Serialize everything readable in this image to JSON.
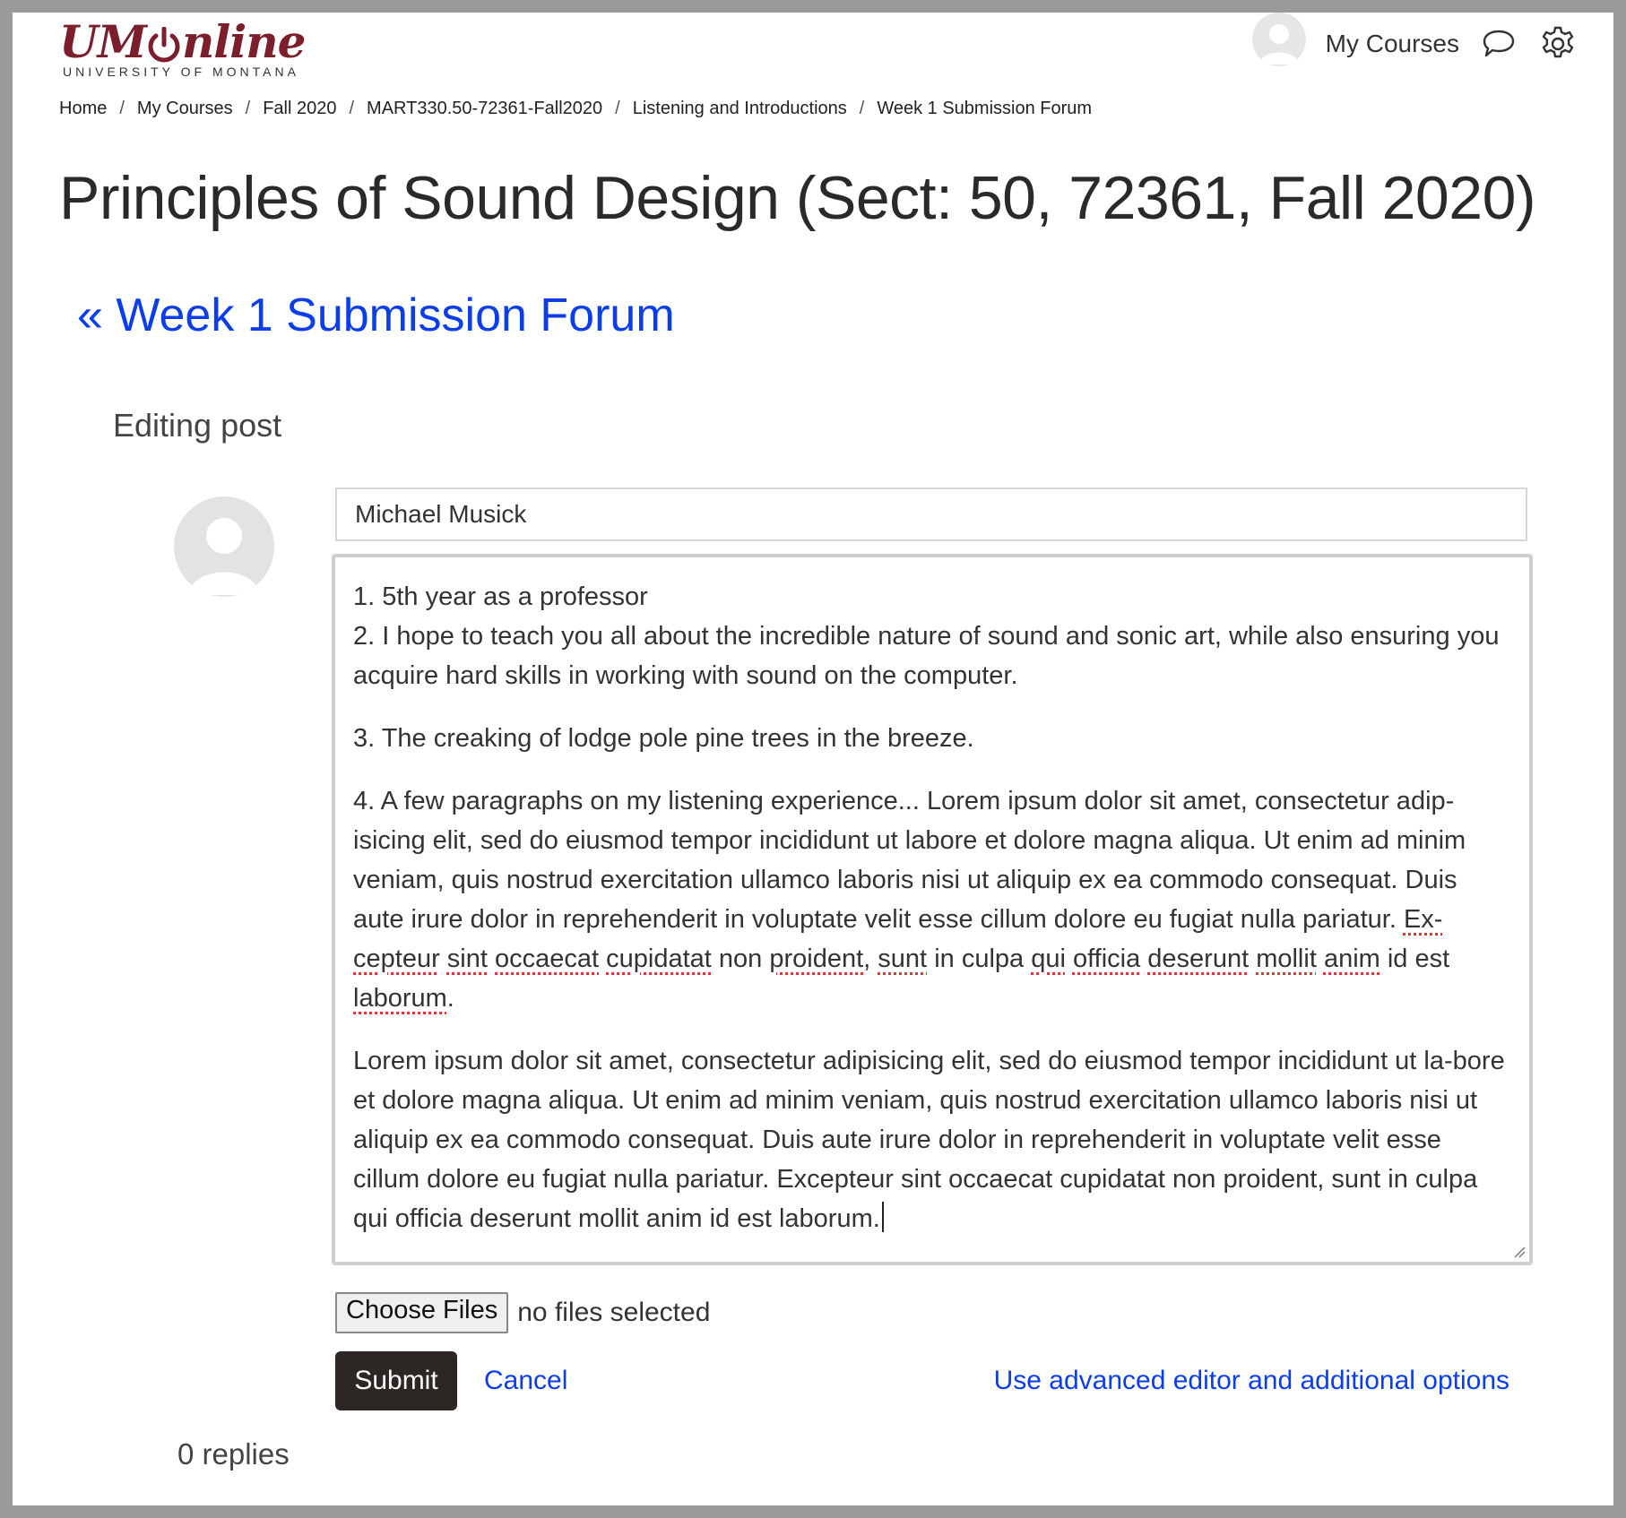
{
  "header": {
    "logo_main": "UM",
    "logo_main_rest": "nline",
    "logo_sub": "UNIVERSITY OF MONTANA",
    "my_courses": "My Courses",
    "brand_color": "#7a1f2b"
  },
  "breadcrumb": [
    {
      "label": "Home"
    },
    {
      "label": "My Courses"
    },
    {
      "label": "Fall 2020"
    },
    {
      "label": "MART330.50-72361-Fall2020"
    },
    {
      "label": "Listening and Introductions"
    },
    {
      "label": "Week 1 Submission Forum"
    }
  ],
  "breadcrumb_separator": "/",
  "page_title": "Principles of Sound Design (Sect: 50, 72361, Fall 2020)",
  "back_link": "« Week 1 Submission Forum",
  "editing_label": "Editing post",
  "post": {
    "subject_value": "Michael Musick",
    "message": {
      "line1": "1. 5th year as a professor",
      "line2": "2. I hope to teach you all about the incredible nature of sound and sonic art, while also ensuring you acquire hard skills in working with sound on the computer.",
      "line3": "3. The creaking of lodge pole pine trees in the breeze.",
      "para4_start": "4. A few paragraphs on my listening experience... Lorem ipsum dolor sit amet, consectetur adip-isicing elit, sed do eiusmod tempor incididunt ut labore et dolore magna aliqua. Ut enim ad minim veniam, quis nostrud exercitation ullamco laboris nisi ut aliquip ex ea commodo consequat. Duis aute irure dolor in reprehenderit in voluptate velit esse cillum dolore eu fugiat nulla pariatur.",
      "para4_w1": "Ex-cepteur",
      "para4_w2": "sint",
      "para4_w3": "occaecat",
      "para4_w4": "cupidatat",
      "para4_t1": "non",
      "para4_w5": "proident",
      "para4_t2": ",",
      "para4_w6": "sunt",
      "para4_t3": "in culpa",
      "para4_w7": "qui",
      "para4_w8": "officia",
      "para4_w9": "deserunt",
      "para4_w10": "mollit",
      "para4_w11": "anim",
      "para4_t4": "id est",
      "para4_w12": "laborum",
      "para4_end": ".",
      "para5": "Lorem ipsum dolor sit amet, consectetur adipisicing elit, sed do eiusmod tempor incididunt ut la-bore et dolore magna aliqua. Ut enim ad minim veniam, quis nostrud exercitation ullamco laboris nisi ut aliquip ex ea commodo consequat. Duis aute irure dolor in reprehenderit in voluptate velit esse cillum dolore eu fugiat nulla pariatur. Excepteur sint occaecat cupidatat non proident, sunt in culpa qui officia deserunt mollit anim id est laborum."
    }
  },
  "attachments": {
    "button_label": "Choose Files",
    "status": "no files selected"
  },
  "actions": {
    "submit": "Submit",
    "cancel": "Cancel",
    "advanced": "Use advanced editor and additional options"
  },
  "replies": "0 replies",
  "colors": {
    "link": "#0b3ee8",
    "submit_bg": "#2c2624",
    "frame": "#9a9a9a"
  }
}
